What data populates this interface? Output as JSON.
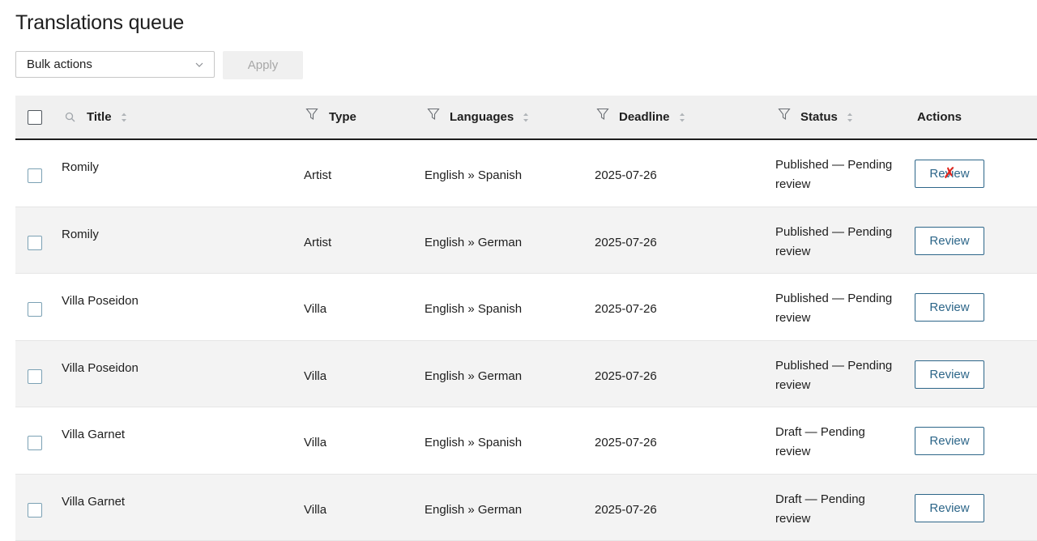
{
  "page": {
    "title": "Translations queue"
  },
  "toolbar": {
    "bulk_actions_label": "Bulk actions",
    "apply_label": "Apply"
  },
  "table": {
    "headers": {
      "title": "Title",
      "type": "Type",
      "languages": "Languages",
      "deadline": "Deadline",
      "status": "Status",
      "actions": "Actions"
    },
    "rows": [
      {
        "title": "Romily",
        "type": "Artist",
        "languages": "English » Spanish",
        "deadline": "2025-07-26",
        "status": "Published — Pending review",
        "action": "Review"
      },
      {
        "title": "Romily",
        "type": "Artist",
        "languages": "English » German",
        "deadline": "2025-07-26",
        "status": "Published — Pending review",
        "action": "Review"
      },
      {
        "title": "Villa Poseidon",
        "type": "Villa",
        "languages": "English » Spanish",
        "deadline": "2025-07-26",
        "status": "Published — Pending review",
        "action": "Review"
      },
      {
        "title": "Villa Poseidon",
        "type": "Villa",
        "languages": "English » German",
        "deadline": "2025-07-26",
        "status": "Published — Pending review",
        "action": "Review"
      },
      {
        "title": "Villa Garnet",
        "type": "Villa",
        "languages": "English » Spanish",
        "deadline": "2025-07-26",
        "status": "Draft — Pending review",
        "action": "Review"
      },
      {
        "title": "Villa Garnet",
        "type": "Villa",
        "languages": "English » German",
        "deadline": "2025-07-26",
        "status": "Draft — Pending review",
        "action": "Review"
      }
    ]
  },
  "icons": {
    "search": "search-icon",
    "filter": "filter-icon",
    "sort": "sort-icon",
    "chevron": "chevron-down-icon",
    "cursor_marker": "x-marker-icon"
  },
  "colors": {
    "accent": "#2d6689",
    "marker": "#e2231a",
    "header_bg": "#f0f0f0",
    "alt_row_bg": "#f3f3f3"
  }
}
